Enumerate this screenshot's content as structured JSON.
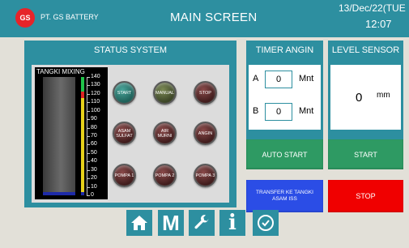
{
  "header": {
    "logo_text": "GS",
    "company": "PT. GS BATTERY",
    "title": "MAIN SCREEN",
    "date": "13/Dec/22(TUE",
    "time": "12:07"
  },
  "status_system": {
    "title": "STATUS SYSTEM",
    "tank": {
      "label": "TANGKI MIXING",
      "scale": [
        "140",
        "130",
        "120",
        "110",
        "100",
        "90",
        "80",
        "70",
        "60",
        "50",
        "40",
        "30",
        "20",
        "10",
        "0"
      ],
      "level_percent": 3
    },
    "buttons": [
      {
        "label": "START"
      },
      {
        "label": "MANUAL"
      },
      {
        "label": "STOP"
      },
      {
        "label": "ASAM SULFAT"
      },
      {
        "label": "AIR MURNI"
      },
      {
        "label": "ANGIN"
      },
      {
        "label": "POMPA 1"
      },
      {
        "label": "POMPA 2"
      },
      {
        "label": "POMPA 3"
      }
    ]
  },
  "timer_angin": {
    "title": "TIMER ANGIN",
    "rows": [
      {
        "label": "A",
        "value": "0",
        "unit": "Mnt"
      },
      {
        "label": "B",
        "value": "0",
        "unit": "Mnt"
      }
    ]
  },
  "level_sensor": {
    "title": "LEVEL SENSOR",
    "value": "0",
    "unit": "mm"
  },
  "actions": {
    "auto_start": "AUTO START",
    "start": "START",
    "transfer": "TRANSFER KE TANGKI ASAM ISS",
    "stop": "STOP"
  },
  "nav": {
    "home_glyph": "⌂",
    "m_label": "M",
    "info_glyph": "i"
  },
  "colors": {
    "header": "#2d8fa0",
    "panel": "#2d8fa0",
    "background": "#e2e0d8",
    "auto_start": "#2e9a63",
    "start": "#2e9a63",
    "transfer": "#2b4de6",
    "stop": "#f00000",
    "logo": "#e62429"
  },
  "icons": {
    "home": "home-icon",
    "menu": "m-icon",
    "tools": "wrench-icon",
    "info": "info-icon",
    "time": "clock-icon"
  }
}
